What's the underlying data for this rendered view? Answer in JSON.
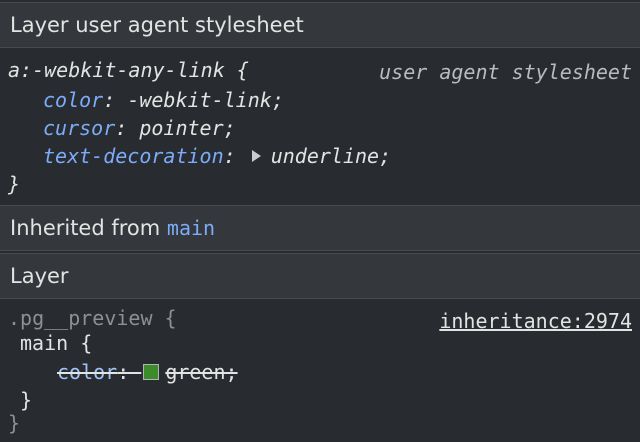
{
  "sections": {
    "layer_ua_header": "Layer user agent stylesheet",
    "inherited_prefix": "Inherited from ",
    "inherited_element": "main",
    "layer_header": "Layer"
  },
  "rule1": {
    "selector": "a:-webkit-any-link {",
    "origin": "user agent stylesheet",
    "decl1_prop": "color",
    "decl1_value": "-webkit-link",
    "decl2_prop": "cursor",
    "decl2_value": "pointer",
    "decl3_prop": "text-decoration",
    "decl3_value": "underline",
    "close": "}"
  },
  "rule2": {
    "outer_selector": ".pg__preview {",
    "source": "inheritance:2974",
    "inner_selector": "main {",
    "decl1_prop": "color",
    "decl1_value": "green",
    "swatch_color": "#3c8c2a",
    "inner_close": "}",
    "outer_close": "}"
  },
  "punct": {
    "colon": ": ",
    "semicolon": ";"
  },
  "colors": {
    "background": "#282b2f",
    "header_bg": "#34373b",
    "property": "#7cacf8",
    "link": "#7cacf8"
  }
}
